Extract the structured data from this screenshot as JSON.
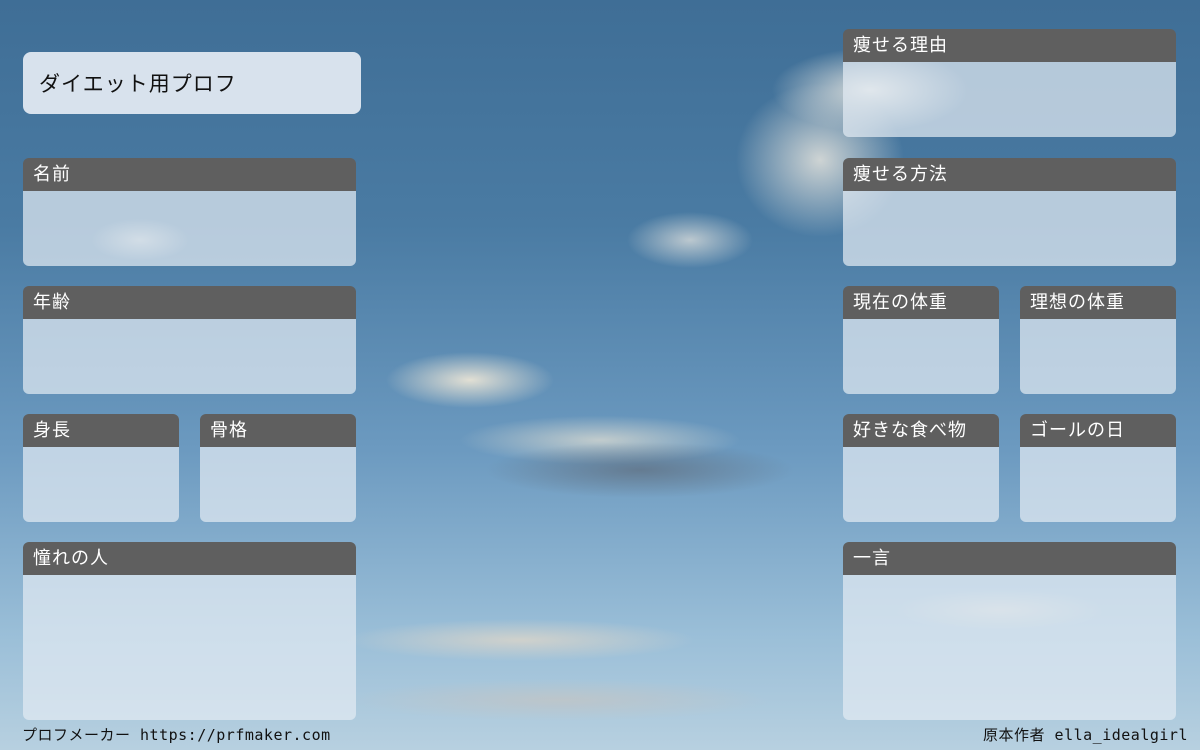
{
  "title": "ダイエット用プロフ",
  "fields": {
    "name": "名前",
    "age": "年齢",
    "height": "身長",
    "frame": "骨格",
    "idol": "憧れの人",
    "reason": "痩せる理由",
    "method": "痩せる方法",
    "current_weight": "現在の体重",
    "ideal_weight": "理想の体重",
    "favorite_food": "好きな食べ物",
    "goal_date": "ゴールの日",
    "comment": "一言"
  },
  "footer": {
    "left": "プロフメーカー https://prfmaker.com",
    "right": "原本作者 ella_idealgirl"
  }
}
